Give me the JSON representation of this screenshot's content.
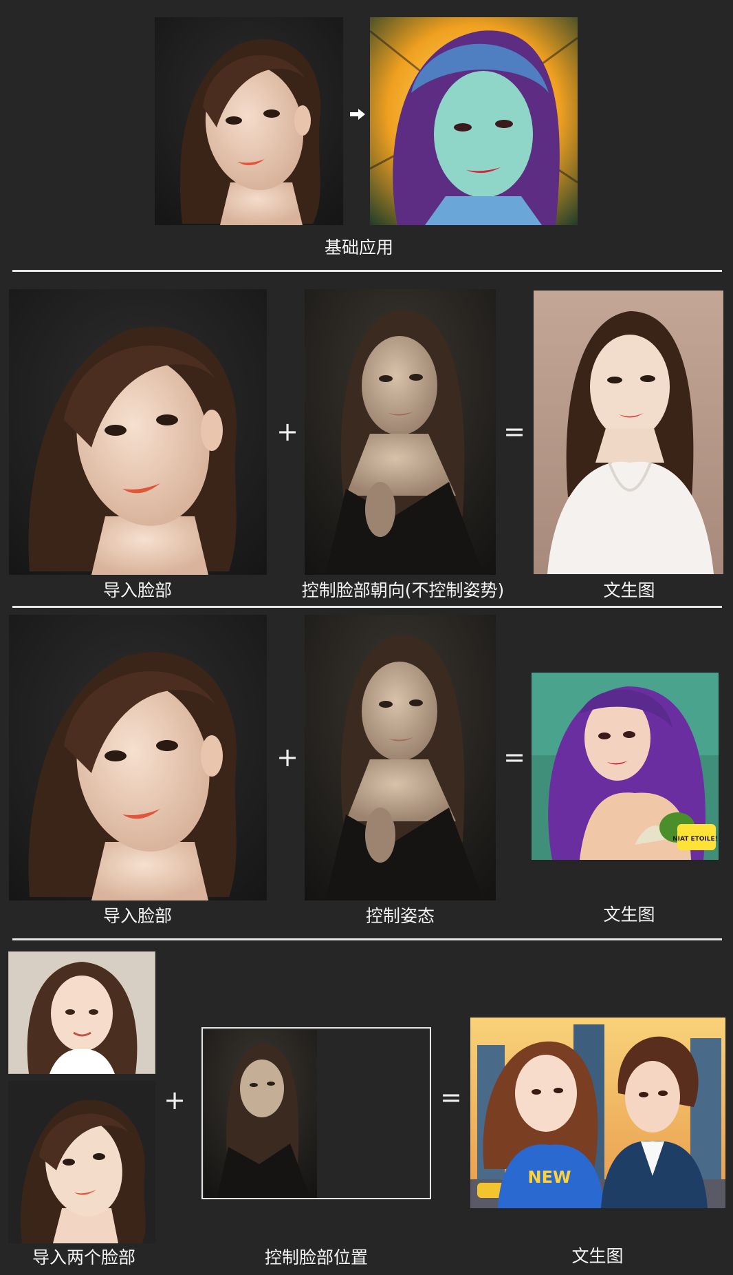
{
  "sections": [
    {
      "id": "basic",
      "caption": "基础应用"
    },
    {
      "id": "face-orientation",
      "captions": [
        "导入脸部",
        "控制脸部朝向(不控制姿势)",
        "文生图"
      ],
      "operators": [
        "+",
        "="
      ]
    },
    {
      "id": "pose",
      "captions": [
        "导入脸部",
        "控制姿态",
        "文生图"
      ],
      "operators": [
        "+",
        "="
      ],
      "comic_badge": "NIAT ETOILE!!"
    },
    {
      "id": "two-faces",
      "captions": [
        "导入两个脸部",
        "控制脸部位置",
        "文生图"
      ],
      "operators": [
        "+",
        "="
      ],
      "shirt_text": "NEW"
    }
  ],
  "colors": {
    "background": "#262626",
    "divider": "#e6e6e6",
    "text": "#f4f4f4"
  },
  "icons": [
    "arrow-right-icon"
  ]
}
